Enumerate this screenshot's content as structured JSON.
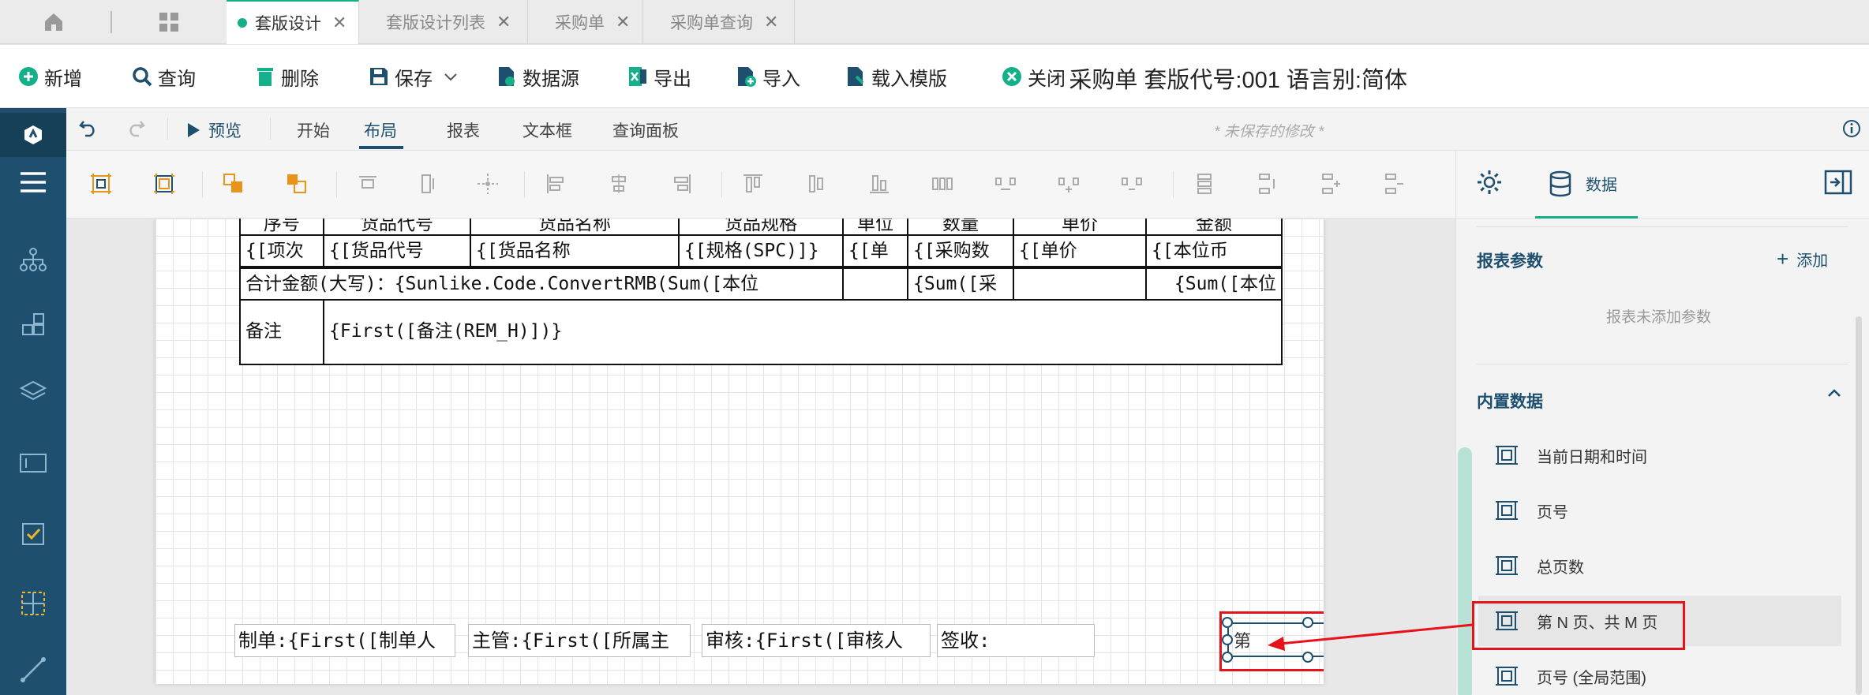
{
  "tabs": {
    "items": [
      {
        "label": "套版设计",
        "active": true
      },
      {
        "label": "套版设计列表",
        "active": false
      },
      {
        "label": "采购单",
        "active": false
      },
      {
        "label": "采购单查询",
        "active": false
      }
    ]
  },
  "toolbar": {
    "new_label": "新增",
    "query_label": "查询",
    "delete_label": "删除",
    "save_label": "保存",
    "datasource_label": "数据源",
    "export_label": "导出",
    "import_label": "导入",
    "loadtemplate_label": "载入模版",
    "close_label": "关闭"
  },
  "doc_title": "采购单 套版代号:001 语言别:简体",
  "submenu": {
    "preview": "预览",
    "start": "开始",
    "layout": "布局",
    "report": "报表",
    "textbox": "文本框",
    "querypanel": "查询面板",
    "unsaved": "* 未保存的修改 *"
  },
  "right_panel": {
    "data_tab": "数据",
    "report_params_title": "报表参数",
    "add_label": "添加",
    "no_params": "报表未添加参数",
    "builtin_title": "内置数据",
    "builtin_items": [
      "当前日期和时间",
      "页号",
      "总页数",
      "第 N 页、共 M 页",
      "页号 (全局范围)"
    ]
  },
  "report": {
    "header_cells": [
      "序号",
      "货品代号",
      "货品名称",
      "货品规格",
      "单位",
      "数量",
      "单价",
      "金额"
    ],
    "detail_cells": [
      "{[项次",
      "{[货品代号",
      "{[货品名称",
      "{[规格(SPC)]}",
      "{[单",
      "{[采购数",
      "{[单价",
      "{[本位币"
    ],
    "total_label": "合计金额(大写)：",
    "total_expr": "{Sunlike.Code.ConvertRMB(Sum([本位",
    "total_qty": "{Sum([采",
    "total_amt": "{Sum([本位",
    "remark_label": "备注",
    "remark_expr": "{First([备注(REM_H)])}",
    "footer": [
      {
        "label": "制单:",
        "expr": "{First([制单人"
      },
      {
        "label": "主管:",
        "expr": "{First([所属主"
      },
      {
        "label": "审核:",
        "expr": "{First([审核人"
      },
      {
        "label": "签收:",
        "expr": ""
      }
    ],
    "page_field": "第"
  },
  "colors": {
    "brand": "#1e4f6e",
    "accent": "#14b08a",
    "highlight": "#e8131a"
  }
}
